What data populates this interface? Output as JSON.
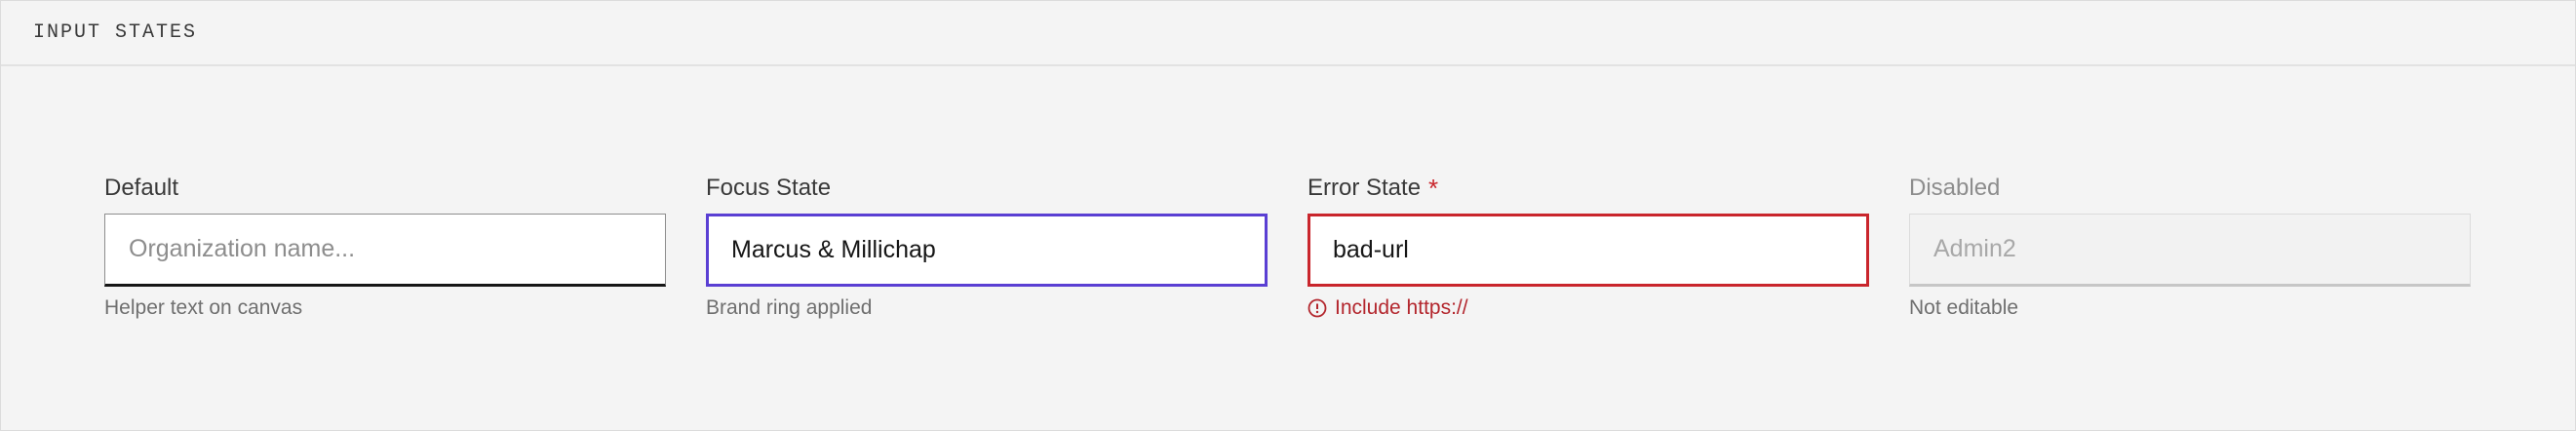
{
  "panel": {
    "title": "INPUT STATES"
  },
  "fields": [
    {
      "label": "Default",
      "placeholder": "Organization name...",
      "value": "",
      "helper": "Helper text on canvas"
    },
    {
      "label": "Focus State",
      "value": "Marcus & Millichap",
      "helper": "Brand ring applied"
    },
    {
      "label": "Error State",
      "required_marker": "*",
      "value": "bad-url",
      "helper": "Include https://",
      "helper_icon": "error-circle-icon"
    },
    {
      "label": "Disabled",
      "value": "Admin2",
      "helper": "Not editable"
    }
  ],
  "colors": {
    "focus_ring": "#5a3fd3",
    "error": "#c9252c",
    "background": "#f4f4f4"
  }
}
